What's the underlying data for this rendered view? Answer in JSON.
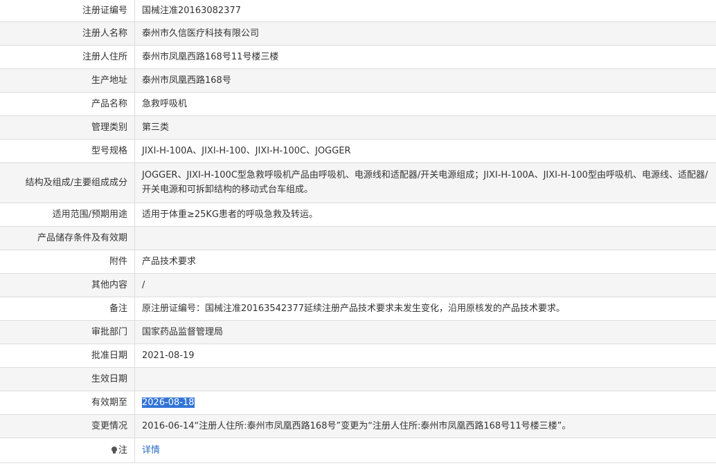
{
  "rows": [
    {
      "label": "注册证编号",
      "value": "国械注准20163082377"
    },
    {
      "label": "注册人名称",
      "value": "泰州市久信医疗科技有限公司"
    },
    {
      "label": "注册人住所",
      "value": "泰州市凤凰西路168号11号楼三楼"
    },
    {
      "label": "生产地址",
      "value": "泰州市凤凰西路168号"
    },
    {
      "label": "产品名称",
      "value": "急救呼吸机"
    },
    {
      "label": "管理类别",
      "value": "第三类"
    },
    {
      "label": "型号规格",
      "value": "JIXI-H-100A、JIXI-H-100、JIXI-H-100C、JOGGER"
    },
    {
      "label": "结构及组成/主要组成成分",
      "value": "JOGGER、JIXI-H-100C型急救呼吸机产品由呼吸机、电源线和适配器/开关电源组成；JIXI-H-100A、JIXI-H-100型由呼吸机、电源线、适配器/开关电源和可拆卸结构的移动式台车组成。"
    },
    {
      "label": "适用范围/预期用途",
      "value": "适用于体重≥25KG患者的呼吸急救及转运。"
    },
    {
      "label": "产品储存条件及有效期",
      "value": ""
    },
    {
      "label": "附件",
      "value": "产品技术要求"
    },
    {
      "label": "其他内容",
      "value": "/"
    },
    {
      "label": "备注",
      "value": "原注册证编号：国械注准20163542377延续注册产品技术要求未发生变化，沿用原核发的产品技术要求。"
    },
    {
      "label": "审批部门",
      "value": "国家药品监督管理局"
    },
    {
      "label": "批准日期",
      "value": "2021-08-19"
    },
    {
      "label": "生效日期",
      "value": ""
    },
    {
      "label": "有效期至",
      "value": "2026-08-18"
    },
    {
      "label": "变更情况",
      "value": "2016-06-14“注册人住所:泰州市凤凰西路168号”变更为“注册人住所:泰州市凤凰西路168号11号楼三楼”。"
    },
    {
      "label": "注",
      "value": "详情"
    }
  ],
  "icons": {
    "note_icon": "lightbulb-icon"
  },
  "colors": {
    "selection": "#3375d6",
    "link": "#2a6cc4",
    "alt_row": "#f5f5f5"
  }
}
